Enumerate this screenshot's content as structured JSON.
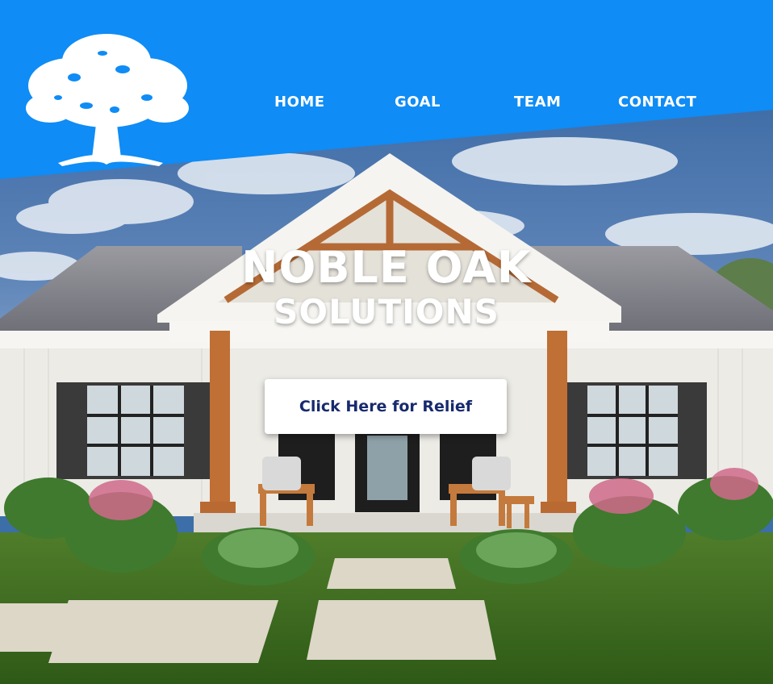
{
  "brand": {
    "logo_icon": "oak-tree-icon",
    "title_line1": "NOBLE OAK",
    "title_line2": "SOLUTIONS"
  },
  "nav": {
    "items": [
      {
        "label": "HOME"
      },
      {
        "label": "GOAL"
      },
      {
        "label": "TEAM"
      },
      {
        "label": "CONTACT"
      }
    ]
  },
  "hero": {
    "cta_label": "Click Here for Relief"
  },
  "colors": {
    "header_blue": "#0f8cf5",
    "cta_text": "#172a6e",
    "white": "#ffffff"
  }
}
